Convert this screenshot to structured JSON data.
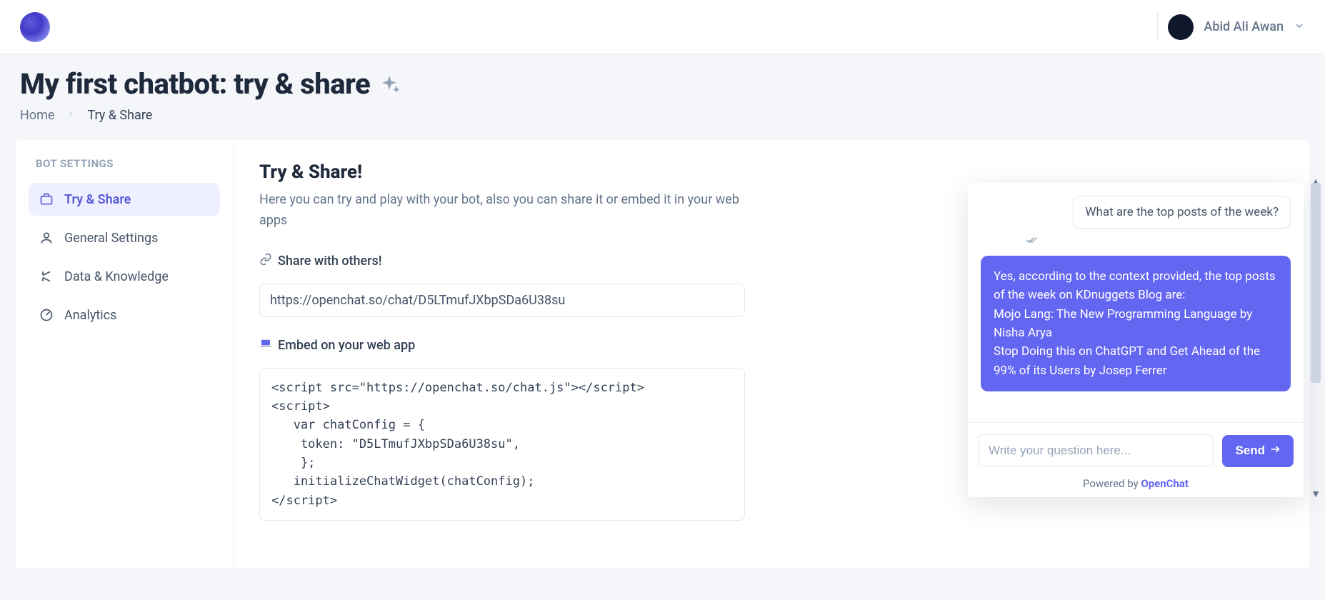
{
  "header": {
    "username": "Abid Ali Awan"
  },
  "page": {
    "title": "My first chatbot: try & share",
    "breadcrumb": {
      "home": "Home",
      "current": "Try & Share"
    }
  },
  "sidebar": {
    "heading": "BOT SETTINGS",
    "items": [
      {
        "label": "Try & Share"
      },
      {
        "label": "General Settings"
      },
      {
        "label": "Data & Knowledge"
      },
      {
        "label": "Analytics"
      }
    ]
  },
  "main": {
    "title": "Try & Share!",
    "subtitle": "Here you can try and play with your bot, also you can share it or embed it in your web apps",
    "share_label": "Share with others!",
    "share_url": "https://openchat.so/chat/D5LTmufJXbpSDa6U38su",
    "embed_label": "Embed on your web app",
    "embed_code": "<script src=\"https://openchat.so/chat.js\"></script>\n<script>\n   var chatConfig = {\n    token: \"D5LTmufJXbpSDa6U38su\",\n    };\n   initializeChatWidget(chatConfig);\n</script>"
  },
  "chat": {
    "user_msg": "What are the top posts of the week?",
    "bot_msg": "Yes, according to the context provided, the top posts of the week on KDnuggets Blog are:\nMojo Lang: The New Programming Language by Nisha Arya\nStop Doing this on ChatGPT and Get Ahead of the 99% of its Users by Josep Ferrer",
    "placeholder": "Write your question here...",
    "send_label": "Send",
    "powered_prefix": "Powered by ",
    "powered_brand": "OpenChat"
  }
}
